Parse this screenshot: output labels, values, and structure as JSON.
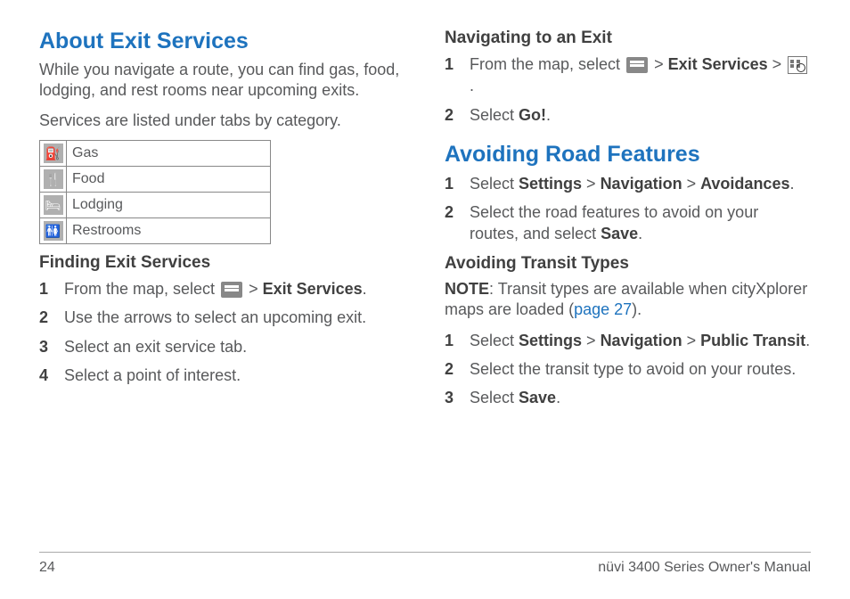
{
  "left": {
    "title": "About Exit Services",
    "intro1": "While you navigate a route, you can find gas, food, lodging, and rest rooms near upcoming exits.",
    "intro2": "Services are listed under tabs by category.",
    "table": {
      "gas": "Gas",
      "food": "Food",
      "lodging": "Lodging",
      "restrooms": "Restrooms"
    },
    "finding": {
      "title": "Finding Exit Services",
      "step1a": "From the map, select ",
      "step1b": " > ",
      "step1c": "Exit Services",
      "step1d": ".",
      "step2": "Use the arrows to select an upcoming exit.",
      "step3": "Select an exit service tab.",
      "step4": "Select a point of interest."
    }
  },
  "right": {
    "nav": {
      "title": "Navigating to an Exit",
      "step1a": "From the map, select ",
      "step1b": " > ",
      "step1c": "Exit Services",
      "step1d": " > ",
      "step1e": ".",
      "step2a": "Select ",
      "step2b": "Go!",
      "step2c": "."
    },
    "avoid": {
      "title": "Avoiding Road Features",
      "step1a": "Select ",
      "step1b": "Settings",
      "step1c": " > ",
      "step1d": "Navigation",
      "step1e": " > ",
      "step1f": "Avoidances",
      "step1g": ".",
      "step2a": "Select the road features to avoid on your routes, and select ",
      "step2b": "Save",
      "step2c": "."
    },
    "transit": {
      "title": "Avoiding Transit Types",
      "note_label": "NOTE",
      "note_text": ": Transit types are available when cityXplorer maps are loaded (",
      "note_link": "page 27",
      "note_close": ").",
      "step1a": "Select ",
      "step1b": "Settings",
      "step1c": " > ",
      "step1d": "Navigation",
      "step1e": " > ",
      "step1f": "Public Transit",
      "step1g": ".",
      "step2": "Select the transit type to avoid on your routes.",
      "step3a": "Select ",
      "step3b": "Save",
      "step3c": "."
    }
  },
  "footer": {
    "page": "24",
    "manual": "nüvi 3400 Series Owner's Manual"
  }
}
